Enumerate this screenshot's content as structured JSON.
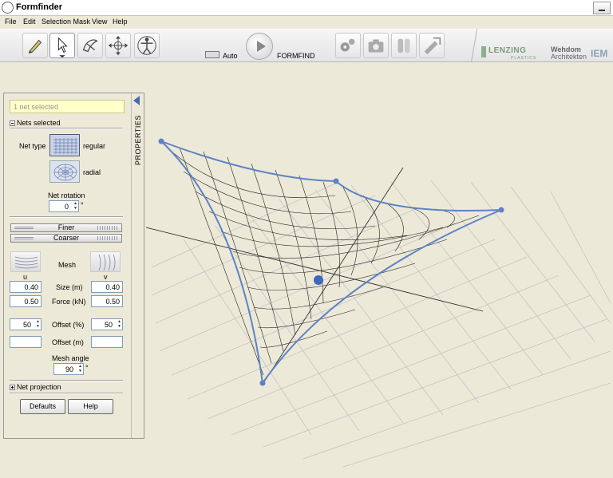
{
  "window": {
    "title": "Formfinder"
  },
  "menu": [
    "File",
    "Edit",
    "Selection Mask",
    "View",
    "Help"
  ],
  "toolbar": {
    "auto_label": "Auto",
    "formfind_label": "FORMFIND"
  },
  "logos": {
    "lenzing": "LENZING",
    "lenzing_sub": "PLASTICS",
    "wehdom1": "Wehdom",
    "wehdom2": "Architekten",
    "third": "IEM"
  },
  "panel": {
    "properties_tab": "PROPERTIES",
    "selection_status": "1 net selected",
    "nets_selected": "Nets selected",
    "net_type_label": "Net type",
    "net_type_regular": "regular",
    "net_type_radial": "radial",
    "net_rotation_label": "Net rotation",
    "net_rotation_value": "0",
    "degree": "°",
    "finer_label": "Finer",
    "coarser_label": "Coarser",
    "mesh_label": "Mesh",
    "u_label": "u",
    "v_label": "v",
    "size_label": "Size (m)",
    "size_u": "0.40",
    "size_v": "0.40",
    "force_label": "Force (kN)",
    "force_u": "0.50",
    "force_v": "0.50",
    "offset_pct_label": "Offset (%)",
    "offset_pct_u": "50",
    "offset_pct_v": "50",
    "offset_m_label": "Offset (m)",
    "offset_m_u": "",
    "offset_m_v": "",
    "mesh_angle_label": "Mesh angle",
    "mesh_angle_value": "90",
    "net_projection": "Net projection",
    "defaults_label": "Defaults",
    "help_label": "Help"
  }
}
